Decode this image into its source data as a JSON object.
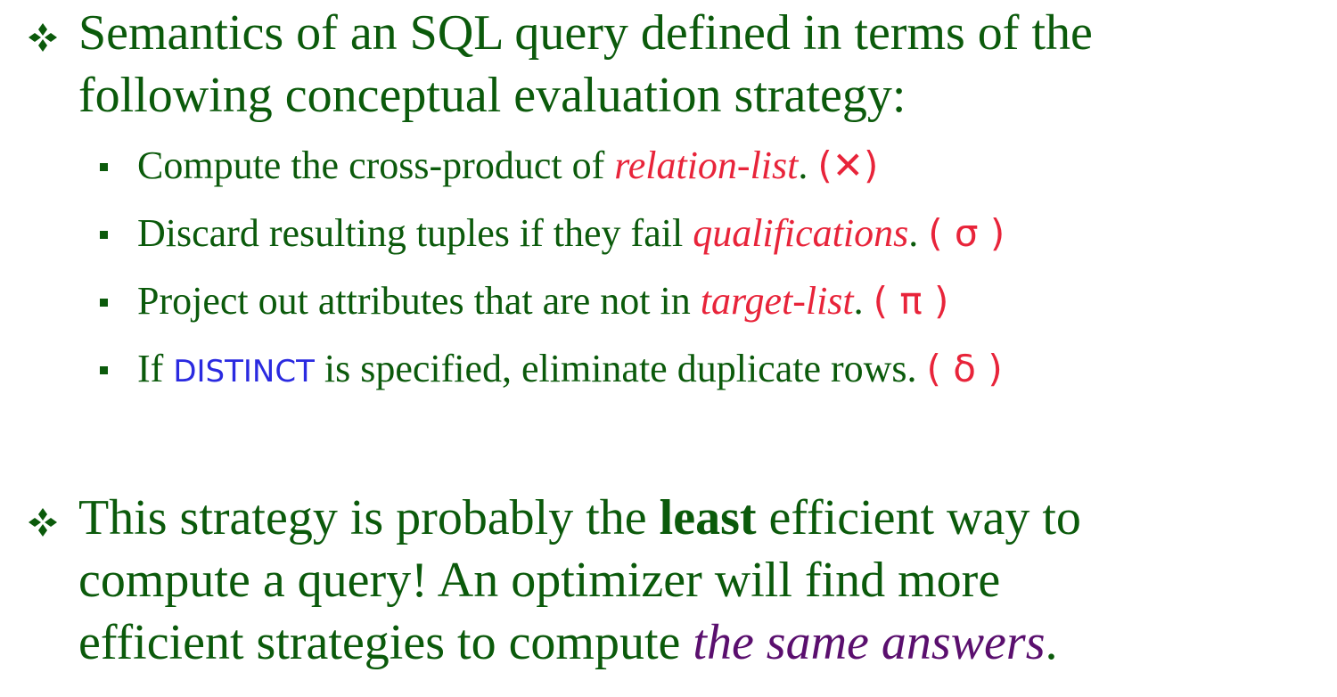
{
  "bullet1": {
    "line1": " Semantics of an SQL query defined in terms of the",
    "line2": "following conceptual evaluation strategy:"
  },
  "steps": [
    {
      "text": "Compute the cross-product of ",
      "term": "relation-list",
      "after": ".",
      "symbol": "(✕)"
    },
    {
      "text": "Discard resulting tuples if they fail ",
      "term": "qualifications",
      "after": ".",
      "symbol": "( σ )"
    },
    {
      "text": "Project out attributes that are not in ",
      "term": "target-list",
      "after": ".",
      "symbol": "( π )"
    },
    {
      "text_before": "If ",
      "keyword": "DISTINCT",
      "text_after": " is specified, eliminate duplicate rows. ",
      "symbol": "( δ )"
    }
  ],
  "bullet2": {
    "line1_before": "This strategy is probably the ",
    "line1_bold": "least",
    "line1_after": " efficient way to",
    "line2": "compute a query!  An optimizer will find more",
    "line3_before": "efficient strategies to compute ",
    "line3_italic": "the same answers",
    "line3_after": "."
  },
  "icons": {
    "bullet_level1": "four-diamond-icon",
    "bullet_level2": "square-bullet-icon"
  },
  "colors": {
    "text": "#0b5a0b",
    "highlight_red": "#e8243a",
    "keyword_blue": "#2a2ae0",
    "emphasis_purple": "#5a0f6e"
  }
}
